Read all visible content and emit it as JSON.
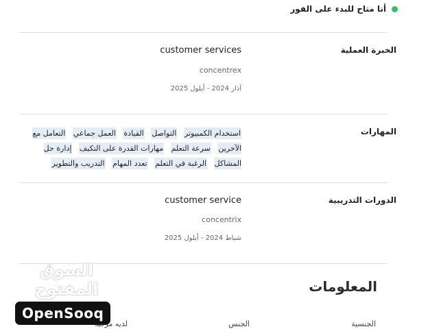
{
  "status": {
    "text": "أنا متاح للبدء على الفور",
    "color": "#3dbb6a"
  },
  "experience": {
    "label": "الخبرة العملية",
    "title": "customer services",
    "company": "concentrex",
    "dates": "آذار 2024 - أيلول 2025"
  },
  "skills": {
    "label": "المهارات",
    "items": [
      "استخدام الكمبيوتر",
      "التواصل",
      "القيادة",
      "العمل جماعي",
      "التعامل مع الآخرين",
      "سرعة التعلم",
      "مهارات القدرة على التكيف",
      "إدارة حل المشاكل",
      "الرغبة في التعلم",
      "تعدد المهام",
      "التدريب والتطوير"
    ]
  },
  "training": {
    "label": "الدورات التدريبية",
    "title": "customer service",
    "company": "concentrix",
    "dates": "شباط 2024 - أيلول 2025"
  },
  "info": {
    "title": "المعلومات",
    "fields": [
      "الجنسية",
      "الجنس",
      "لديه مركبة"
    ]
  },
  "watermark": {
    "arabic": "السوق المفتوح",
    "logo": "OpenSooq"
  }
}
